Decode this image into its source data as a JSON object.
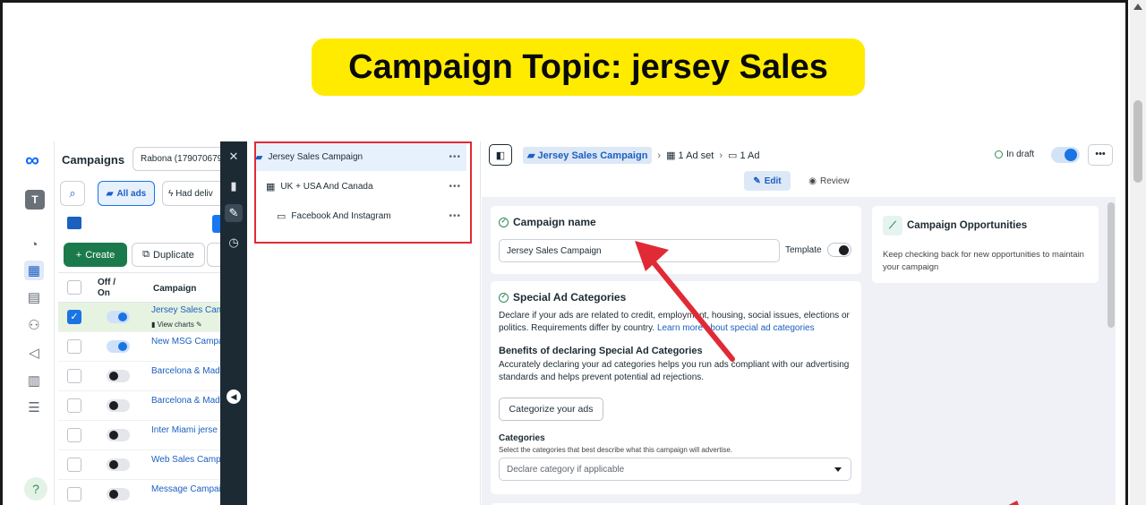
{
  "banner": {
    "title": "Campaign Topic: jersey Sales"
  },
  "leftnav": {
    "logo": "∞",
    "avatar": "T",
    "help": "?"
  },
  "campaigns": {
    "title": "Campaigns",
    "account": "Rabona (179070679",
    "all_ads": "All ads",
    "had_delivery": "Had deliv",
    "create": "Create",
    "duplicate": "Duplicate",
    "col_off_on": "Off / On",
    "col_campaign": "Campaign",
    "view_charts": "View charts",
    "rows": [
      {
        "name": "Jersey Sales Camp",
        "on": true,
        "selected": true
      },
      {
        "name": "New MSG Campa",
        "on": true
      },
      {
        "name": "Barcelona & Mad",
        "on": false
      },
      {
        "name": "Barcelona & Mad",
        "on": false
      },
      {
        "name": "Inter Miami jerse",
        "on": false
      },
      {
        "name": "Web Sales Camp",
        "on": false
      },
      {
        "name": "Message Campai",
        "on": false
      }
    ]
  },
  "tree": {
    "campaign": "Jersey Sales Campaign",
    "adset": "UK + USA And Canada",
    "ad": "Facebook And Instagram",
    "dots": "•••"
  },
  "editor": {
    "breadcrumb_campaign": "Jersey Sales Campaign",
    "breadcrumb_adset": "1 Ad set",
    "breadcrumb_ad": "1 Ad",
    "status": "In draft",
    "more": "•••",
    "edit": "Edit",
    "review": "Review",
    "campaign_name_title": "Campaign name",
    "campaign_name_value": "Jersey Sales Campaign",
    "template_label": "Template",
    "sac_title": "Special Ad Categories",
    "sac_desc_a": "Declare if your ads are related to credit, employment, housing, social issues, elections or politics. Requirements differ by country. ",
    "sac_desc_link": "Learn more about special ad categories",
    "benefits_title": "Benefits of declaring Special Ad Categories",
    "benefits_desc": "Accurately declaring your ad categories helps you run ads compliant with our advertising standards and helps prevent potential ad rejections.",
    "categorize_btn": "Categorize your ads",
    "categories_label": "Categories",
    "categories_help": "Select the categories that best describe what this campaign will advertise.",
    "categories_placeholder": "Declare category if applicable",
    "opps_title": "Campaign Opportunities",
    "opps_desc": "Keep checking back for new opportunities to maintain your campaign"
  },
  "colors": {
    "accent": "#1b74e4",
    "banner": "#ffeb00",
    "highlight": "#e02a35",
    "create": "#1b7a4b"
  }
}
